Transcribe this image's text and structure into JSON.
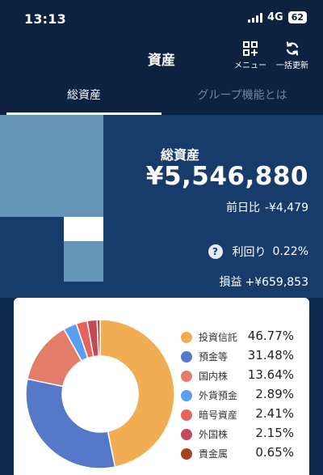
{
  "status_bar": {
    "time": "13:13",
    "network": "4G",
    "battery": "62"
  },
  "header": {
    "title": "資産",
    "menu_label": "メニュー",
    "refresh_label": "一括更新"
  },
  "tabs": [
    {
      "label": "総資産",
      "active": true
    },
    {
      "label": "グループ機能とは",
      "active": false
    }
  ],
  "summary": {
    "total_label": "総資産",
    "total_value": "¥5,546,880",
    "day_over_day_label": "前日比",
    "day_over_day_value": "-¥4,479",
    "yield_label": "利回り",
    "yield_value": "0.22%",
    "pnl_label": "損益",
    "pnl_value": "+¥659,853"
  },
  "colors": {
    "header_bg": "#0d2240",
    "summary_bg": "#173c6b",
    "treemap": "#6494b6"
  },
  "chart_data": {
    "type": "pie",
    "categories": [
      "投資信託",
      "預金等",
      "国内株",
      "外貨預金",
      "暗号資産",
      "外国株",
      "貴金属"
    ],
    "values": [
      46.77,
      31.48,
      13.64,
      2.89,
      2.41,
      2.15,
      0.65
    ],
    "value_labels": [
      "46.77%",
      "31.48%",
      "13.64%",
      "2.89%",
      "2.41%",
      "2.15%",
      "0.65%"
    ],
    "colors": [
      "#f0ad52",
      "#5578c9",
      "#e47c6a",
      "#5a9ef0",
      "#e5635d",
      "#c24a5a",
      "#a8421f"
    ],
    "legend": "right"
  }
}
